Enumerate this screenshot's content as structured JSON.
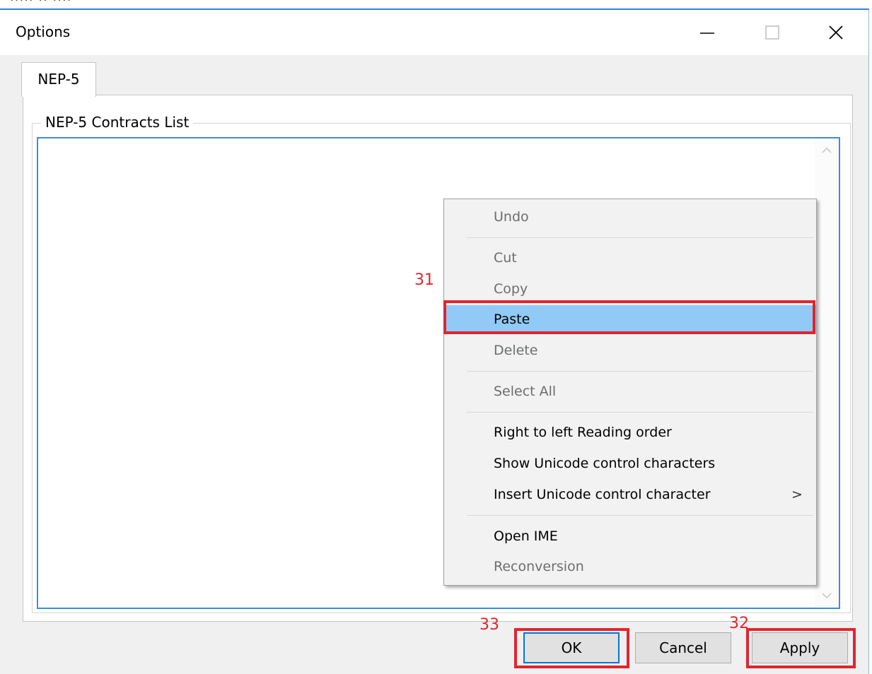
{
  "background_menu_fragment": "····· ·· ····",
  "window": {
    "title": "Options",
    "controls": [
      "minimize",
      "maximize",
      "close"
    ]
  },
  "tabs": [
    {
      "label": "NEP-5",
      "selected": true
    }
  ],
  "group": {
    "label": "NEP-5 Contracts List",
    "textarea_value": ""
  },
  "context_menu": {
    "items": [
      {
        "label": "Undo",
        "enabled": false
      },
      {
        "label": "Cut",
        "enabled": false
      },
      {
        "label": "Copy",
        "enabled": false
      },
      {
        "label": "Paste",
        "enabled": true,
        "highlighted": true
      },
      {
        "label": "Delete",
        "enabled": false
      },
      {
        "label": "Select All",
        "enabled": false
      },
      {
        "label": "Right to left Reading order",
        "enabled": true
      },
      {
        "label": "Show Unicode control characters",
        "enabled": true
      },
      {
        "label": "Insert Unicode control character",
        "enabled": true,
        "submenu_indicator": ">"
      },
      {
        "label": "Open IME",
        "enabled": true
      },
      {
        "label": "Reconversion",
        "enabled": false
      }
    ]
  },
  "annotations": [
    {
      "number": "31",
      "target": "Paste"
    },
    {
      "number": "32",
      "target": "Apply"
    },
    {
      "number": "33",
      "target": "OK"
    }
  ],
  "buttons": {
    "ok": "OK",
    "cancel": "Cancel",
    "apply": "Apply"
  },
  "colors": {
    "accent": "#0078d7",
    "menu_highlight": "#91c9f7",
    "annotation_red": "#e0252f",
    "dialog_bg": "#f0f0f0"
  }
}
